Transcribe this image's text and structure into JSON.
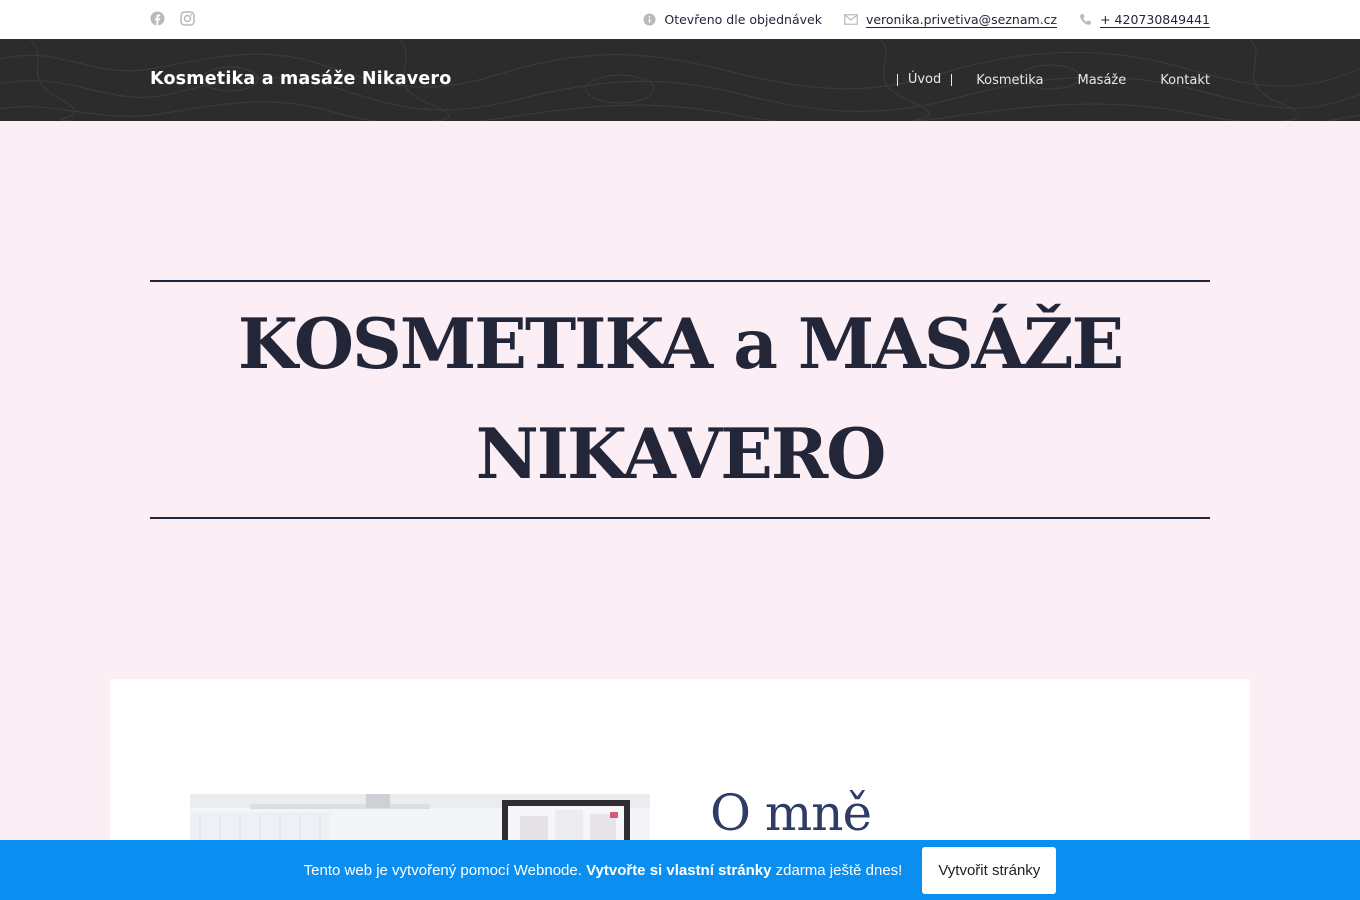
{
  "topbar": {
    "social": [
      "facebook-icon",
      "instagram-icon"
    ],
    "hours": "Otevřeno dle objednávek",
    "email": "veronika.privetiva@seznam.cz",
    "phone": "+ 420730849441"
  },
  "header": {
    "brand": "Kosmetika a masáže Nikavero",
    "nav": [
      {
        "label": "Úvod",
        "active": true
      },
      {
        "label": "Kosmetika",
        "active": false
      },
      {
        "label": "Masáže",
        "active": false
      },
      {
        "label": "Kontakt",
        "active": false
      }
    ]
  },
  "hero": {
    "title_line1": "KOSMETIKA a MASÁŽE",
    "title_line2": "NIKAVERO"
  },
  "about": {
    "title": "O mně"
  },
  "promo": {
    "text_before": "Tento web je vytvořený pomocí Webnode.",
    "text_bold": "Vytvořte si vlastní stránky",
    "text_after": "zdarma ještě dnes!",
    "button": "Vytvořit stránky"
  },
  "colors": {
    "background": "#fbeff5",
    "header": "#2c2c2c",
    "text_dark": "#222638",
    "about_title": "#2f3d66",
    "promo_bar": "#0a8ef0"
  }
}
